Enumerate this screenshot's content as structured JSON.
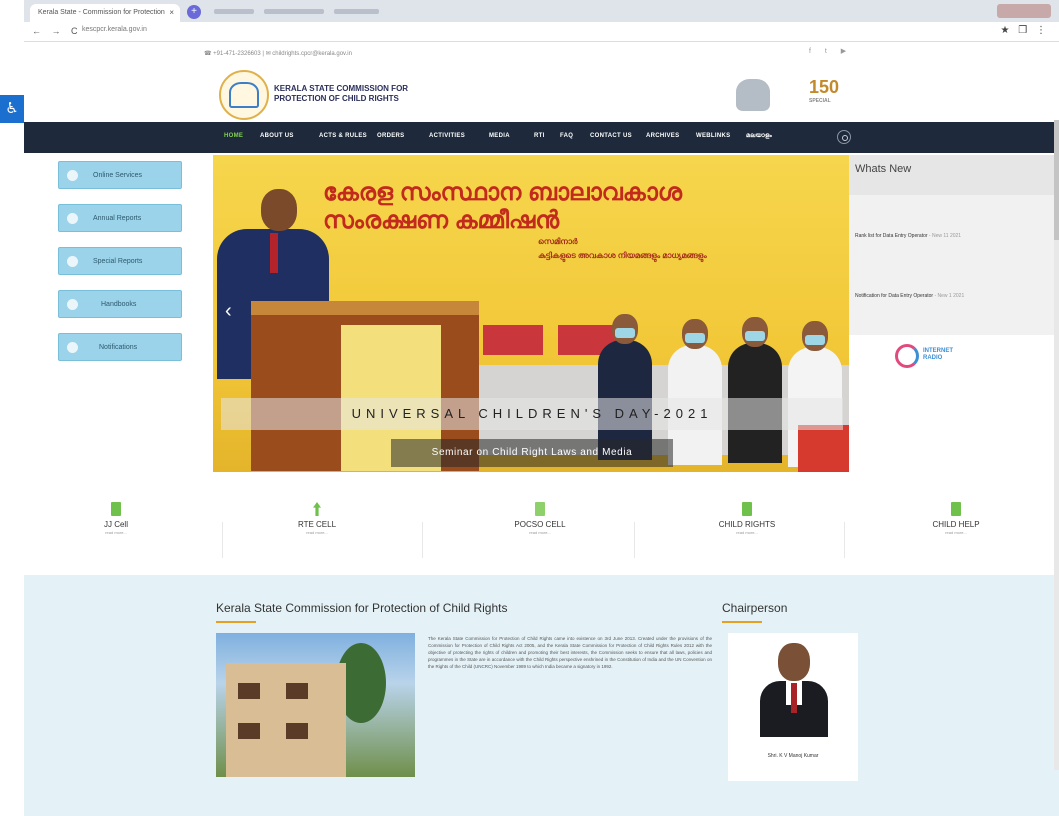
{
  "browser": {
    "tab_title": "Kerala State - Commission for Protection",
    "tab_close": "×",
    "new_tab": "+",
    "nav": "← → C",
    "url": "kescpcr.kerala.gov.in",
    "extensions": "★ ❒ ⋮"
  },
  "topbar": {
    "contact": "☎ +91-471-2326603  |  ✉ childrights.cpcr@kerala.gov.in",
    "social": "f t ▶"
  },
  "header": {
    "brand_line1": "KERALA STATE COMMISSION FOR",
    "brand_line2": "PROTECTION OF CHILD RIGHTS",
    "emblem2_text": "150",
    "emblem2_sub": "SPECIAL"
  },
  "accessibility_icon": "♿",
  "nav": {
    "items": [
      "HOME",
      "ABOUT US",
      "ACTS & RULES",
      "ORDERS",
      "ACTIVITIES",
      "MEDIA",
      "RTI",
      "FAQ",
      "CONTACT US",
      "ARCHIVES",
      "WEBLINKS",
      "മലയാളം"
    ]
  },
  "sidebar": {
    "buttons": [
      "Online Services",
      "Annual Reports",
      "Special Reports",
      "Handbooks",
      "Notifications"
    ]
  },
  "slider": {
    "banner_title": "കേരള സംസ്ഥാന ബാലാവകാശ സംരക്ഷണ കമ്മീഷൻ",
    "banner_sub1": "സെമിനാർ",
    "banner_sub2": "കുട്ടികളുടെ അവകാശ നിയമങ്ങളും മാധ്യമങ്ങളും",
    "caption_title": "UNIVERSAL CHILDREN'S DAY-2021",
    "caption_sub": "Seminar on Child Right Laws and Media",
    "prev": "‹"
  },
  "whats_new": {
    "title": "Whats New",
    "items": [
      {
        "text": "Rank list for Data Entry Operator",
        "tag": "- New 11 2021"
      },
      {
        "text": "Notification for Data Entry Operator",
        "tag": "- New 1 2021"
      }
    ],
    "radio_line1": "INTERNET",
    "radio_line2": "RADIO"
  },
  "cells": [
    {
      "title": "JJ Cell",
      "more": "read more..."
    },
    {
      "title": "RTE CELL",
      "more": "read more..."
    },
    {
      "title": "POCSO CELL",
      "more": "read more..."
    },
    {
      "title": "CHILD RIGHTS",
      "more": "read more..."
    },
    {
      "title": "CHILD HELP",
      "more": "read more..."
    }
  ],
  "about": {
    "title": "Kerala State Commission for Protection of Child Rights",
    "text": "The Kerala State Commission for Protection of Child Rights came into existence on 3rd June 2013. Created under the provisions of the Commission for Protection of Child Rights Act 2005, and the Kerala State Commission for Protection of Child Rights Rules 2012 with the objective of protecting the rights of children and promoting their best interests, the Commission seeks to ensure that all laws, policies and programmes in the State are in accordance with the Child Rights perspective enshrined in the Constitution of India and the UN Convention on the Rights of the Child (UNCRC) November 1989 to which India became a signatory in 1992."
  },
  "chairperson": {
    "title": "Chairperson",
    "name": "Shri. K V Manoj Kumar"
  },
  "colors": {
    "navbar": "#1e2a3b",
    "active_nav": "#7fd24a",
    "sidebar_button": "#9ad3ea",
    "accent": "#e6a020",
    "section_bg": "#e4f2f7"
  }
}
